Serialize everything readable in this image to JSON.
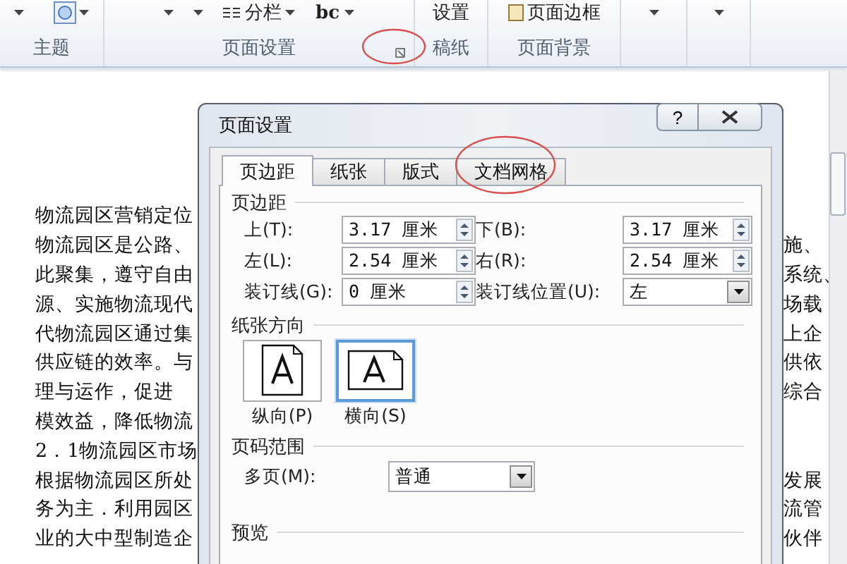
{
  "ribbon": {
    "groups": [
      {
        "label": "主题",
        "items": [
          {
            "kind": "caret"
          },
          {
            "kind": "theme"
          }
        ]
      },
      {
        "label": "页面设置",
        "launcher": true,
        "items": [
          {
            "kind": "caret"
          },
          {
            "kind": "caret"
          },
          {
            "kind": "columns",
            "label": "分栏"
          },
          {
            "kind": "hyphen",
            "label": "bc"
          }
        ]
      },
      {
        "label": "稿纸",
        "items": [
          {
            "kind": "text",
            "label": "设置"
          }
        ]
      },
      {
        "label": "页面背景",
        "items": [
          {
            "kind": "border",
            "label": "页面边框"
          }
        ]
      },
      {
        "items": [
          {
            "kind": "caret"
          }
        ]
      },
      {
        "items": [
          {
            "kind": "caret"
          }
        ]
      }
    ]
  },
  "document": {
    "lines": [
      {
        "left": "物流园区营销定位"
      },
      {
        "left": "物流园区是公路、",
        "right": "施、"
      },
      {
        "left": "此聚集，遵守自由",
        "right": "系统、"
      },
      {
        "left": "源、实施物流现代",
        "right": "场载"
      },
      {
        "left": "代物流园区通过集",
        "right": "上企"
      },
      {
        "left": "供应链的效率。与",
        "right": "供依"
      },
      {
        "left": "理与运作，促进",
        "right": "综合"
      },
      {
        "left": "模效益，降低物流"
      },
      {
        "left": "2．1物流园区市场"
      },
      {
        "left": "根据物流园区所处",
        "right": "发展"
      },
      {
        "left": "务为主．利用园区",
        "right": "流管"
      },
      {
        "left": "业的大中型制造企",
        "right": "伙伴"
      }
    ]
  },
  "dialog": {
    "title": "页面设置",
    "help": "?",
    "tabs": [
      {
        "label": "页边距",
        "selected": true
      },
      {
        "label": "纸张",
        "selected": false
      },
      {
        "label": "版式",
        "selected": false
      },
      {
        "label": "文档网格",
        "selected": false
      }
    ],
    "margins_title": "页边距",
    "margins": [
      {
        "kind": "spin",
        "label": "上(T):",
        "value": "3.17 厘米"
      },
      {
        "kind": "spin",
        "label": "下(B):",
        "value": "3.17 厘米"
      },
      {
        "kind": "spin",
        "label": "左(L):",
        "value": "2.54 厘米"
      },
      {
        "kind": "spin",
        "label": "右(R):",
        "value": "2.54 厘米"
      },
      {
        "kind": "spin",
        "label": "装订线(G):",
        "value": "0 厘米"
      },
      {
        "kind": "select",
        "label": "装订线位置(U):",
        "value": "左"
      }
    ],
    "orientation_title": "纸张方向",
    "orientations": [
      {
        "kind": "portrait",
        "label": "纵向(P)",
        "selected": false
      },
      {
        "kind": "landscape",
        "label": "横向(S)",
        "selected": true
      }
    ],
    "pages_title": "页码范围",
    "pages": {
      "label": "多页(M):",
      "value": "普通"
    },
    "preview_title": "预览"
  }
}
